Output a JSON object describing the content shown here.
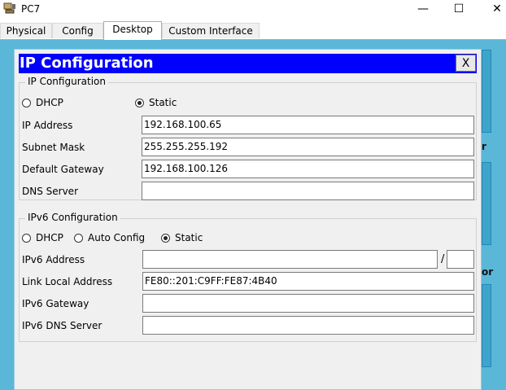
{
  "window": {
    "title": "PC7",
    "minimize_glyph": "—",
    "maximize_glyph": "☐",
    "close_glyph": "✕"
  },
  "tabs": [
    {
      "label": "Physical",
      "active": false
    },
    {
      "label": "Config",
      "active": false
    },
    {
      "label": "Desktop",
      "active": true
    },
    {
      "label": "Custom Interface",
      "active": false
    }
  ],
  "background_fragments": {
    "text1": "r",
    "text2": "or"
  },
  "dialog": {
    "title": "IP Configuration",
    "close_label": "X",
    "ipv4": {
      "legend": "IP Configuration",
      "mode_options": [
        "DHCP",
        "Static"
      ],
      "selected_mode": "Static",
      "ip_address_label": "IP Address",
      "ip_address": "192.168.100.65",
      "subnet_mask_label": "Subnet Mask",
      "subnet_mask": "255.255.255.192",
      "default_gateway_label": "Default Gateway",
      "default_gateway": "192.168.100.126",
      "dns_server_label": "DNS Server",
      "dns_server": ""
    },
    "ipv6": {
      "legend": "IPv6 Configuration",
      "mode_options": [
        "DHCP",
        "Auto Config",
        "Static"
      ],
      "selected_mode": "Static",
      "ipv6_address_label": "IPv6 Address",
      "ipv6_address": "",
      "prefix_separator": "/",
      "prefix_length": "",
      "link_local_label": "Link Local Address",
      "link_local_address": "FE80::201:C9FF:FE87:4B40",
      "gateway_label": "IPv6 Gateway",
      "gateway": "",
      "dns_server_label": "IPv6 DNS Server",
      "dns_server": ""
    }
  },
  "colors": {
    "dialog_title_bg": "#0000ff",
    "desktop_bg": "#5bb7d7"
  }
}
